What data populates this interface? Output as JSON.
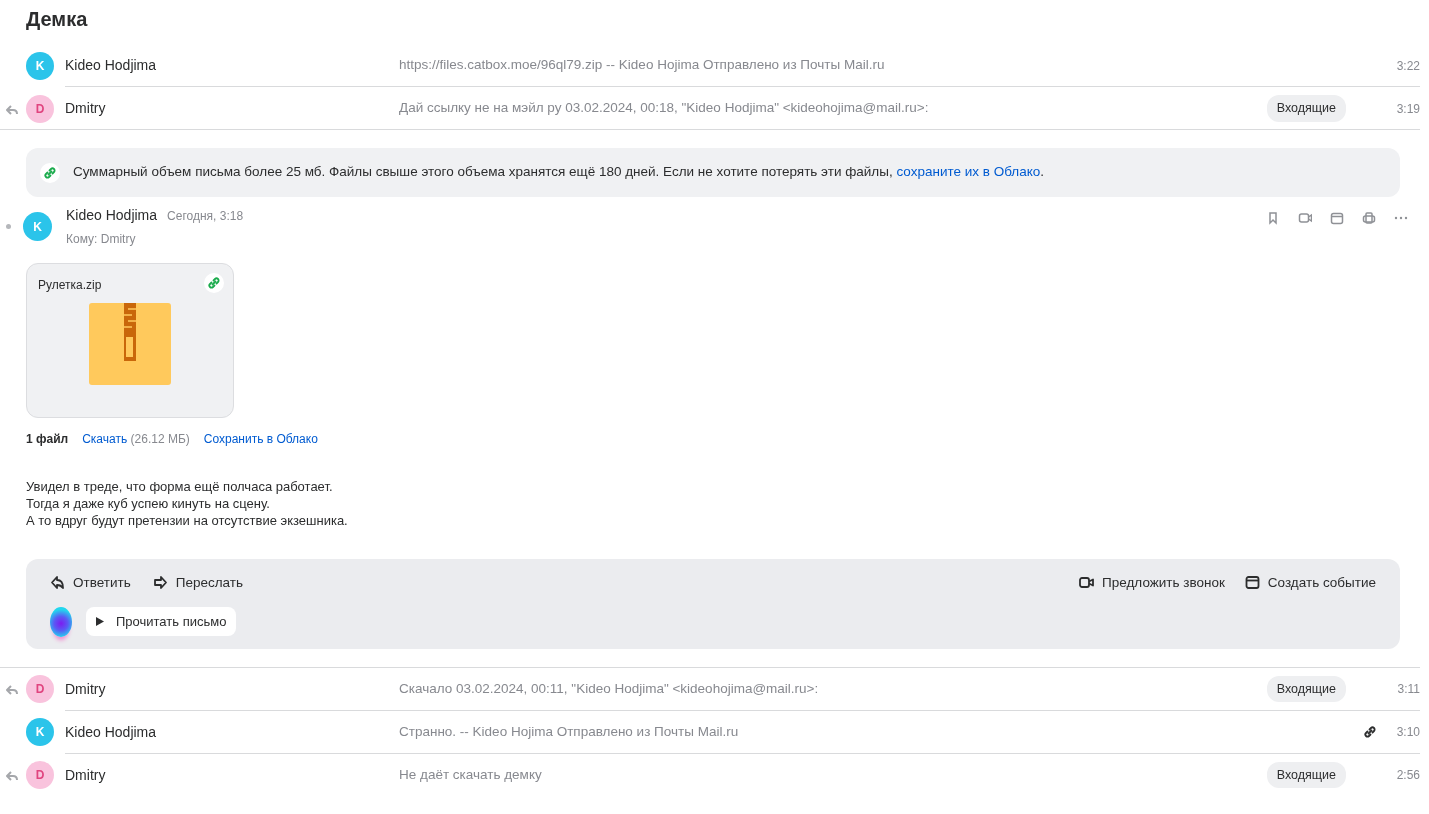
{
  "title": "Демка",
  "threads_before": [
    {
      "sender": "Kideo Hodjima",
      "initial": "K",
      "color": "#2bc4ea",
      "replied": false,
      "snippet": "https://files.catbox.moe/96ql79.zip -- Kideo Hojima Отправлено из Почты Mail.ru",
      "time": "3:22",
      "has_link": false
    },
    {
      "sender": "Dmitry",
      "initial": "D",
      "color": "#f9c3dd",
      "replied": true,
      "snippet": "Дай ссылку не на мэйл ру 03.02.2024, 00:18, \"Kideo Hodjima\" <kideohojima@mail.ru>:",
      "folder": "Входящие",
      "time": "3:19",
      "has_link": false
    }
  ],
  "notice": {
    "text": "Суммарный объем письма более 25 мб. Файлы свыше этого объема хранятся ещё 180 дней. Если не хотите потерять эти файлы, ",
    "link": "сохраните их в Облако",
    "tail": "."
  },
  "message": {
    "sender": "Kideo Hodjima",
    "initial": "K",
    "color": "#2bc4ea",
    "date": "Сегодня, 3:18",
    "to": "Кому: Dmitry",
    "attachment": {
      "name": "Рулетка.zip",
      "count": "1 файл",
      "download": "Скачать",
      "size": "(26.12 МБ)",
      "save": "Сохранить в Облако"
    },
    "body": [
      "Увидел в треде, что форма ещё полчаса работает.",
      "Тогда я даже куб успею кинуть на сцену.",
      "А то вдруг будут претензии на отсутствие экзешника."
    ],
    "actions": {
      "reply": "Ответить",
      "forward": "Переслать",
      "call": "Предложить звонок",
      "event": "Создать событие",
      "read": "Прочитать письмо"
    }
  },
  "threads_after": [
    {
      "sender": "Dmitry",
      "initial": "D",
      "color": "#f9c3dd",
      "replied": true,
      "snippet": "Скачало 03.02.2024, 00:11, \"Kideo Hodjima\" <kideohojima@mail.ru>:",
      "folder": "Входящие",
      "time": "3:11",
      "has_link": false
    },
    {
      "sender": "Kideo Hodjima",
      "initial": "K",
      "color": "#2bc4ea",
      "replied": false,
      "snippet": "Странно. -- Kideo Hojima Отправлено из Почты Mail.ru",
      "time": "3:10",
      "has_link": true
    },
    {
      "sender": "Dmitry",
      "initial": "D",
      "color": "#f9c3dd",
      "replied": true,
      "snippet": "Не даёт скачать демку",
      "folder": "Входящие",
      "time": "2:56",
      "has_link": false
    }
  ]
}
